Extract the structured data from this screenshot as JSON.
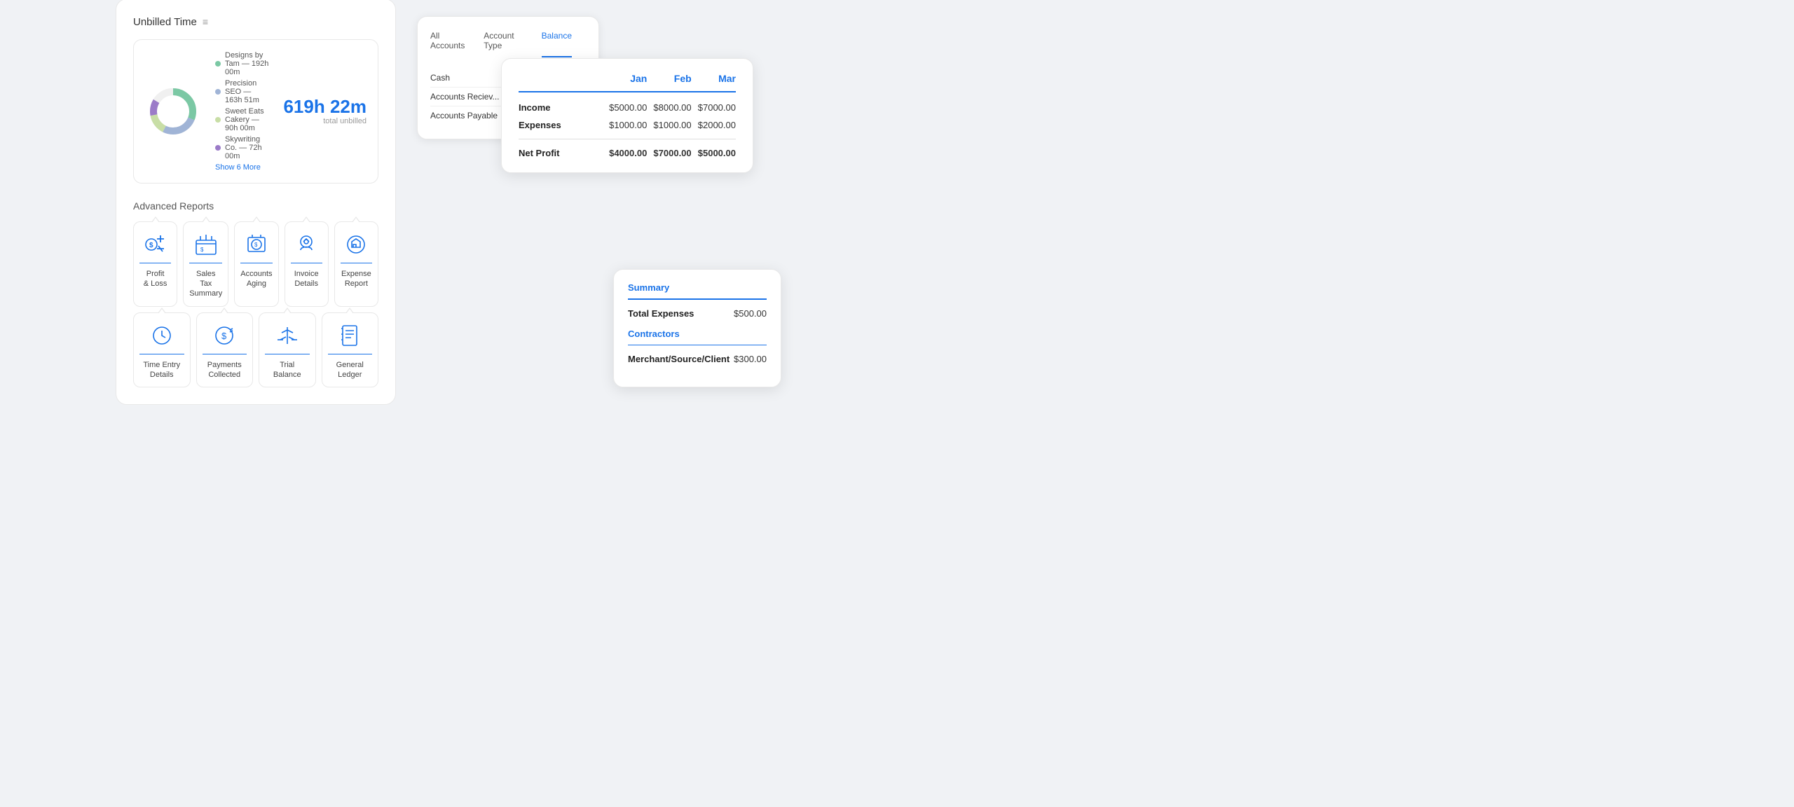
{
  "left": {
    "unbilled_title": "Unbilled Time",
    "total_hours": "619h 22m",
    "total_label": "total unbilled",
    "legend": [
      {
        "label": "Designs by Tam — 192h 00m",
        "color": "#7bc8a4"
      },
      {
        "label": "Precision SEO — 163h 51m",
        "color": "#a0b4d6"
      },
      {
        "label": "Sweet Eats Cakery — 90h 00m",
        "color": "#c8dea6"
      },
      {
        "label": "Skywriting Co. — 72h 00m",
        "color": "#9b7bc8"
      }
    ],
    "show_more": "Show 6 More",
    "advanced_title": "Advanced Reports",
    "reports_row1": [
      {
        "label": "Profit\n& Loss",
        "icon": "profit"
      },
      {
        "label": "Sales Tax\nSummary",
        "icon": "tax"
      },
      {
        "label": "Accounts\nAging",
        "icon": "aging"
      },
      {
        "label": "Invoice\nDetails",
        "icon": "invoice"
      },
      {
        "label": "Expense\nReport",
        "icon": "expense"
      }
    ],
    "reports_row2": [
      {
        "label": "Time Entry\nDetails",
        "icon": "time"
      },
      {
        "label": "Payments\nCollected",
        "icon": "payments"
      },
      {
        "label": "Trial\nBalance",
        "icon": "balance"
      },
      {
        "label": "General\nLedger",
        "icon": "ledger"
      }
    ]
  },
  "accounts": {
    "tabs": [
      "All Accounts",
      "Account Type",
      "Balance"
    ],
    "active_tab": "Balance",
    "col_headers": [
      "",
      ""
    ],
    "rows": [
      "Cash",
      "Accounts Reciev...",
      "Accounts Payable"
    ]
  },
  "profit": {
    "col_headers": [
      "",
      "Jan",
      "Feb",
      "Mar"
    ],
    "rows": [
      {
        "label": "Income",
        "jan": "$5000.00",
        "feb": "$8000.00",
        "mar": "$7000.00"
      },
      {
        "label": "Expenses",
        "jan": "$1000.00",
        "feb": "$1000.00",
        "mar": "$2000.00"
      }
    ],
    "net": {
      "label": "Net Profit",
      "jan": "$4000.00",
      "feb": "$7000.00",
      "mar": "$5000.00"
    }
  },
  "summary": {
    "section1_title": "Summary",
    "total_expenses_label": "Total Expenses",
    "total_expenses_val": "$500.00",
    "section2_title": "Contractors",
    "merchant_label": "Merchant/Source/Client",
    "merchant_val": "$300.00"
  }
}
